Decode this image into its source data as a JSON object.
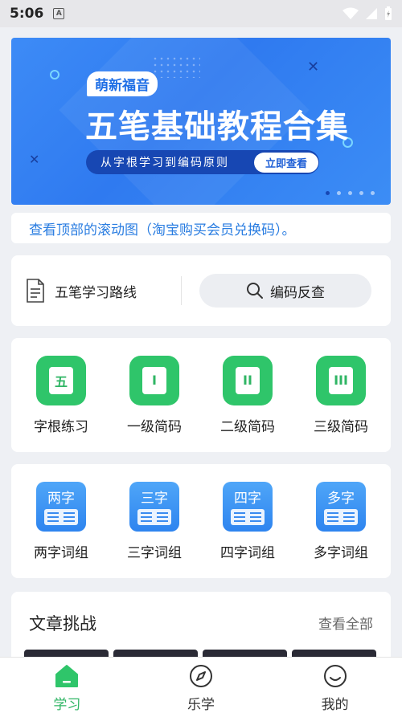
{
  "status_bar": {
    "time": "5:06",
    "badge": "A"
  },
  "banner": {
    "tag": "萌新福音",
    "title": "五笔基础教程合集",
    "subtitle": "从字根学习到编码原则",
    "button": "立即查看",
    "page_count": 5,
    "active_page": 1
  },
  "notice": {
    "text": "查看顶部的滚动图（淘宝购买会员兑换码）。"
  },
  "route": {
    "label": "五笔学习路线",
    "search_label": "编码反查"
  },
  "practice": {
    "items": [
      {
        "glyph": "五",
        "label": "字根练习"
      },
      {
        "glyph": "I",
        "label": "一级简码"
      },
      {
        "glyph": "II",
        "label": "二级简码"
      },
      {
        "glyph": "III",
        "label": "三级简码"
      }
    ]
  },
  "phrases": {
    "items": [
      {
        "glyph": "两字",
        "label": "两字词组"
      },
      {
        "glyph": "三字",
        "label": "三字词组"
      },
      {
        "glyph": "四字",
        "label": "四字词组"
      },
      {
        "glyph": "多字",
        "label": "多字词组"
      }
    ]
  },
  "articles": {
    "title": "文章挑战",
    "more": "查看全部"
  },
  "tabs": [
    {
      "label": "学习",
      "icon": "home-icon"
    },
    {
      "label": "乐学",
      "icon": "compass-icon"
    },
    {
      "label": "我的",
      "icon": "smiley-icon"
    }
  ],
  "colors": {
    "accent_green": "#2fc56a",
    "accent_blue": "#2f7af0",
    "notice_blue": "#2a7de1"
  }
}
